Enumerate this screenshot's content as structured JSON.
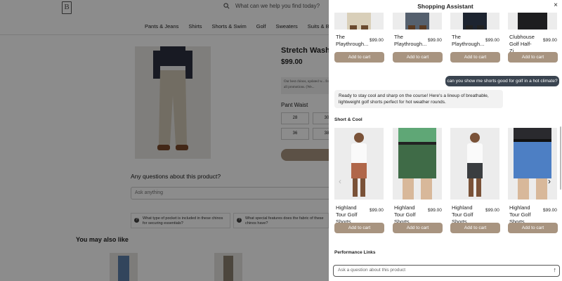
{
  "page": {
    "search_placeholder": "What can we help you find today?",
    "nav": [
      "Pants & Jeans",
      "Shirts",
      "Shorts & Swim",
      "Golf",
      "Sweaters",
      "Suits & Blazers"
    ],
    "product_title": "Stretch Washe",
    "product_price": "$99.00",
    "product_desc": "Our best chinos, updated w... from all promotions. (We...",
    "pant_waist_label": "Pant Waist",
    "sizes": [
      "28",
      "30",
      "36",
      "38"
    ],
    "questions_label": "Any questions about this product?",
    "ask_placeholder": "Ask anything",
    "suggested_questions": [
      "What type of pocket is included in these chinos for securing essentials?",
      "What special features does the fabric of these chinos have?"
    ],
    "you_may_like": "You may also like"
  },
  "assistant": {
    "title": "Shopping Assistant",
    "close_icon": "close-icon",
    "top_products": [
      {
        "name": "The Playthrough...",
        "price": "$99.00",
        "cta": "Add to cart"
      },
      {
        "name": "The Playthrough...",
        "price": "$99.00",
        "cta": "Add to cart"
      },
      {
        "name": "The Playthrough...",
        "price": "$99.00",
        "cta": "Add to cart"
      },
      {
        "name": "Clubhouse Golf Half-Zi...",
        "price": "$99.00",
        "cta": "Add to cart"
      }
    ],
    "user_message": "can you show me shorts good for golf in a hot climate?",
    "bot_message": "Ready to stay cool and sharp on the course! Here's a lineup of breathable, lightweight golf shorts perfect for hot weather rounds.",
    "section_short_cool": "Short & Cool",
    "shorts": [
      {
        "name": "Highland Tour Golf Shorts...",
        "price": "$99.00",
        "cta": "Add to cart",
        "color": "#b0674a"
      },
      {
        "name": "Highland Tour Golf Shorts...",
        "price": "$99.00",
        "cta": "Add to cart",
        "color": "#3f6b47"
      },
      {
        "name": "Highland Tour Golf Shorts...",
        "price": "$99.00",
        "cta": "Add to cart",
        "color": "#3a3d40"
      },
      {
        "name": "Highland Tour Golf Shorts...",
        "price": "$99.00",
        "cta": "Add to cart",
        "color": "#4d7fc4"
      }
    ],
    "section_performance": "Performance Links",
    "input_placeholder": "Ask a question about this product",
    "send_icon": "arrow-up-icon",
    "accent": "#a89480"
  }
}
